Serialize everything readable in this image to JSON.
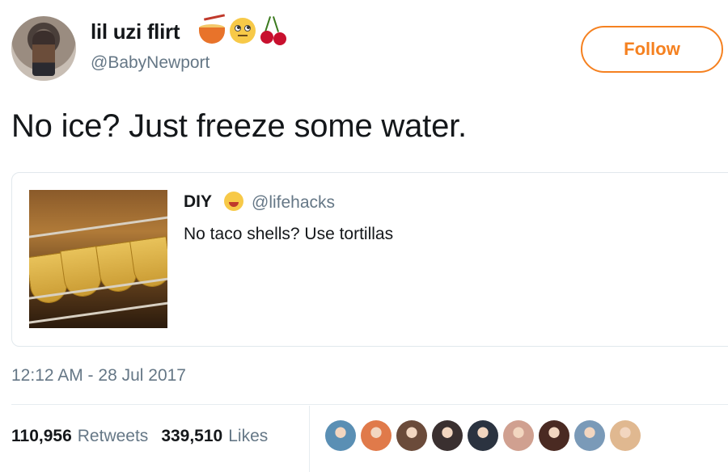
{
  "user": {
    "display_name": "lil uzi flirt",
    "emojis": [
      "ramen-emoji",
      "face-with-rolling-eyes-emoji",
      "cherries-emoji"
    ],
    "handle": "@BabyNewport"
  },
  "follow_button": {
    "label": "Follow",
    "color": "#f58120"
  },
  "tweet": {
    "text": "No ice? Just freeze some water."
  },
  "quoted_tweet": {
    "name": "DIY",
    "emoji": "face-savoring-food-emoji",
    "handle": "@lifehacks",
    "text": "No taco shells? Use tortillas"
  },
  "timestamp": "12:12 AM - 28 Jul 2017",
  "stats": {
    "retweets_count": "110,956",
    "retweets_label": "Retweets",
    "likes_count": "339,510",
    "likes_label": "Likes"
  },
  "likers": [
    {
      "name": "liker-avatar-1",
      "color": "#5a8fb4"
    },
    {
      "name": "liker-avatar-2",
      "color": "#e07a4a"
    },
    {
      "name": "liker-avatar-3",
      "color": "#6b4b3a"
    },
    {
      "name": "liker-avatar-4",
      "color": "#3a3030"
    },
    {
      "name": "liker-avatar-5",
      "color": "#2b3340"
    },
    {
      "name": "liker-avatar-6",
      "color": "#d0a090"
    },
    {
      "name": "liker-avatar-7",
      "color": "#4a2a22"
    },
    {
      "name": "liker-avatar-8",
      "color": "#7a9ab8"
    },
    {
      "name": "liker-avatar-9",
      "color": "#e0b890"
    }
  ],
  "colors": {
    "text": "#14171a",
    "secondary": "#657786",
    "border": "#e1e8ed",
    "accent": "#f58120"
  }
}
